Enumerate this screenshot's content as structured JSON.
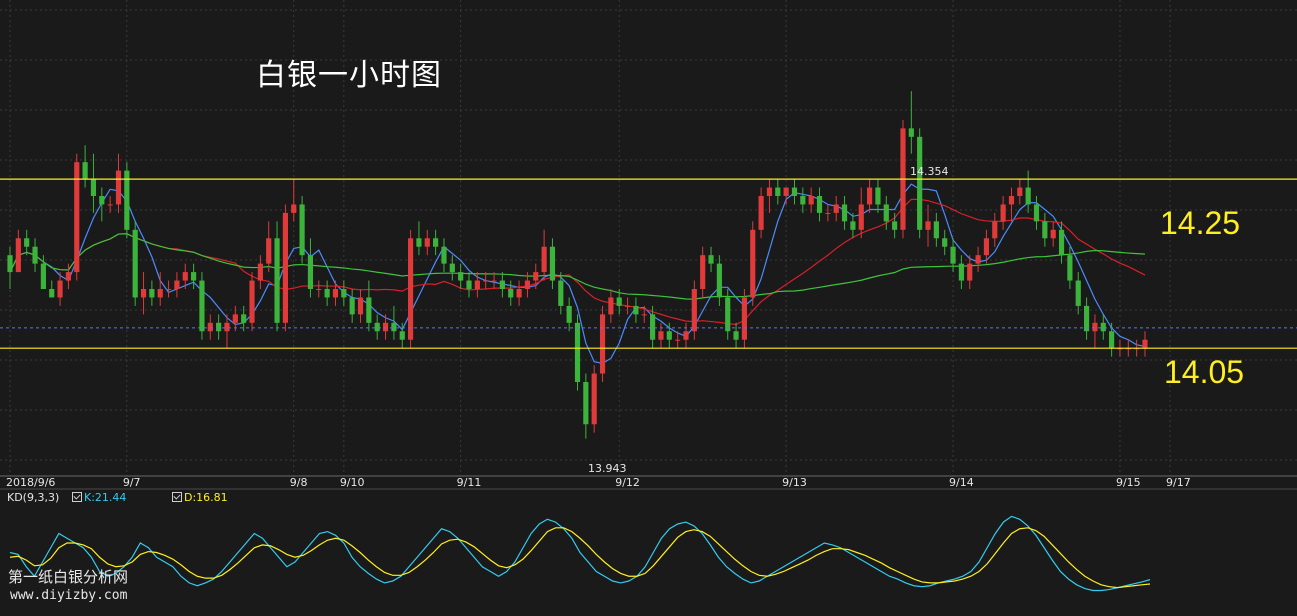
{
  "title": "白银一小时图",
  "chart_data": {
    "type": "candlestick",
    "y_range": [
      13.9,
      14.45
    ],
    "levels": [
      {
        "label": "14.25",
        "value": 14.25,
        "color": "#ffee22"
      },
      {
        "label": "14.05",
        "value": 14.05,
        "color": "#ffee22"
      }
    ],
    "dashed_level": {
      "value": 14.074,
      "color": "#5577ff"
    },
    "extremes": [
      {
        "label": "14.354",
        "value": 14.354
      },
      {
        "label": "13.943",
        "value": 13.943
      }
    ],
    "date_labels": [
      "2018/9/6",
      "9/7",
      "9/8",
      "9/10",
      "9/11",
      "9/12",
      "9/13",
      "9/14",
      "9/15",
      "9/17"
    ],
    "date_label_positions": [
      0,
      14,
      34,
      40,
      54,
      73,
      93,
      113,
      133,
      139
    ],
    "ohlc": [
      [
        14.16,
        14.17,
        14.12,
        14.14
      ],
      [
        14.14,
        14.19,
        14.14,
        14.18
      ],
      [
        14.18,
        14.19,
        14.16,
        14.17
      ],
      [
        14.17,
        14.18,
        14.14,
        14.15
      ],
      [
        14.15,
        14.16,
        14.12,
        14.12
      ],
      [
        14.12,
        14.13,
        14.11,
        14.11
      ],
      [
        14.11,
        14.14,
        14.1,
        14.13
      ],
      [
        14.13,
        14.15,
        14.12,
        14.14
      ],
      [
        14.14,
        14.28,
        14.13,
        14.27
      ],
      [
        14.27,
        14.29,
        14.24,
        14.25
      ],
      [
        14.25,
        14.28,
        14.21,
        14.23
      ],
      [
        14.23,
        14.24,
        14.2,
        14.22
      ],
      [
        14.22,
        14.23,
        14.21,
        14.22
      ],
      [
        14.22,
        14.28,
        14.21,
        14.26
      ],
      [
        14.26,
        14.27,
        14.18,
        14.19
      ],
      [
        14.19,
        14.2,
        14.1,
        14.11
      ],
      [
        14.11,
        14.14,
        14.09,
        14.12
      ],
      [
        14.12,
        14.13,
        14.1,
        14.11
      ],
      [
        14.11,
        14.14,
        14.1,
        14.12
      ],
      [
        14.12,
        14.13,
        14.11,
        14.12
      ],
      [
        14.12,
        14.14,
        14.11,
        14.13
      ],
      [
        14.13,
        14.15,
        14.12,
        14.14
      ],
      [
        14.14,
        14.15,
        14.12,
        14.13
      ],
      [
        14.13,
        14.14,
        14.06,
        14.07
      ],
      [
        14.07,
        14.09,
        14.06,
        14.08
      ],
      [
        14.08,
        14.09,
        14.06,
        14.07
      ],
      [
        14.07,
        14.09,
        14.05,
        14.08
      ],
      [
        14.08,
        14.1,
        14.07,
        14.09
      ],
      [
        14.09,
        14.1,
        14.07,
        14.08
      ],
      [
        14.08,
        14.14,
        14.07,
        14.13
      ],
      [
        14.13,
        14.16,
        14.12,
        14.15
      ],
      [
        14.15,
        14.2,
        14.14,
        14.18
      ],
      [
        14.18,
        14.2,
        14.07,
        14.08
      ],
      [
        14.08,
        14.22,
        14.07,
        14.21
      ],
      [
        14.21,
        14.25,
        14.2,
        14.22
      ],
      [
        14.22,
        14.23,
        14.15,
        14.16
      ],
      [
        14.16,
        14.18,
        14.11,
        14.12
      ],
      [
        14.12,
        14.13,
        14.11,
        14.12
      ],
      [
        14.12,
        14.13,
        14.1,
        14.11
      ],
      [
        14.11,
        14.13,
        14.1,
        14.12
      ],
      [
        14.12,
        14.13,
        14.1,
        14.11
      ],
      [
        14.11,
        14.12,
        14.08,
        14.09
      ],
      [
        14.09,
        14.12,
        14.08,
        14.11
      ],
      [
        14.11,
        14.13,
        14.07,
        14.08
      ],
      [
        14.08,
        14.09,
        14.06,
        14.07
      ],
      [
        14.07,
        14.09,
        14.06,
        14.08
      ],
      [
        14.08,
        14.1,
        14.06,
        14.07
      ],
      [
        14.07,
        14.08,
        14.05,
        14.06
      ],
      [
        14.06,
        14.19,
        14.05,
        14.18
      ],
      [
        14.18,
        14.2,
        14.16,
        14.17
      ],
      [
        14.17,
        14.19,
        14.16,
        14.18
      ],
      [
        14.18,
        14.19,
        14.16,
        14.17
      ],
      [
        14.17,
        14.18,
        14.14,
        14.15
      ],
      [
        14.15,
        14.16,
        14.13,
        14.14
      ],
      [
        14.14,
        14.15,
        14.12,
        14.13
      ],
      [
        14.13,
        14.14,
        14.11,
        14.12
      ],
      [
        14.12,
        14.14,
        14.11,
        14.13
      ],
      [
        14.13,
        14.14,
        14.12,
        14.13
      ],
      [
        14.13,
        14.14,
        14.12,
        14.13
      ],
      [
        14.13,
        14.14,
        14.11,
        14.12
      ],
      [
        14.12,
        14.13,
        14.1,
        14.11
      ],
      [
        14.11,
        14.13,
        14.1,
        14.12
      ],
      [
        14.12,
        14.14,
        14.11,
        14.13
      ],
      [
        14.13,
        14.15,
        14.12,
        14.14
      ],
      [
        14.14,
        14.19,
        14.13,
        14.17
      ],
      [
        14.17,
        14.18,
        14.12,
        14.13
      ],
      [
        14.13,
        14.14,
        14.09,
        14.1
      ],
      [
        14.1,
        14.11,
        14.07,
        14.08
      ],
      [
        14.08,
        14.09,
        14.0,
        14.01
      ],
      [
        14.01,
        14.02,
        13.943,
        13.96
      ],
      [
        13.96,
        14.03,
        13.95,
        14.02
      ],
      [
        14.02,
        14.1,
        14.01,
        14.09
      ],
      [
        14.09,
        14.12,
        14.08,
        14.11
      ],
      [
        14.11,
        14.12,
        14.09,
        14.1
      ],
      [
        14.1,
        14.11,
        14.09,
        14.1
      ],
      [
        14.1,
        14.11,
        14.08,
        14.09
      ],
      [
        14.09,
        14.1,
        14.08,
        14.09
      ],
      [
        14.09,
        14.1,
        14.05,
        14.06
      ],
      [
        14.06,
        14.08,
        14.05,
        14.07
      ],
      [
        14.07,
        14.08,
        14.05,
        14.06
      ],
      [
        14.06,
        14.07,
        14.05,
        14.06
      ],
      [
        14.06,
        14.08,
        14.05,
        14.07
      ],
      [
        14.07,
        14.13,
        14.06,
        14.12
      ],
      [
        14.12,
        14.17,
        14.11,
        14.16
      ],
      [
        14.16,
        14.17,
        14.14,
        14.15
      ],
      [
        14.15,
        14.16,
        14.1,
        14.11
      ],
      [
        14.11,
        14.12,
        14.06,
        14.07
      ],
      [
        14.07,
        14.08,
        14.05,
        14.06
      ],
      [
        14.06,
        14.12,
        14.05,
        14.11
      ],
      [
        14.11,
        14.2,
        14.1,
        14.19
      ],
      [
        14.19,
        14.24,
        14.18,
        14.23
      ],
      [
        14.23,
        14.25,
        14.21,
        14.24
      ],
      [
        14.24,
        14.25,
        14.22,
        14.23
      ],
      [
        14.23,
        14.24,
        14.22,
        14.24
      ],
      [
        14.24,
        14.25,
        14.22,
        14.23
      ],
      [
        14.23,
        14.24,
        14.21,
        14.22
      ],
      [
        14.22,
        14.24,
        14.21,
        14.23
      ],
      [
        14.23,
        14.24,
        14.2,
        14.21
      ],
      [
        14.21,
        14.22,
        14.2,
        14.21
      ],
      [
        14.21,
        14.23,
        14.2,
        14.22
      ],
      [
        14.22,
        14.23,
        14.19,
        14.2
      ],
      [
        14.2,
        14.21,
        14.18,
        14.19
      ],
      [
        14.19,
        14.24,
        14.18,
        14.22
      ],
      [
        14.22,
        14.25,
        14.21,
        14.24
      ],
      [
        14.24,
        14.25,
        14.21,
        14.22
      ],
      [
        14.22,
        14.23,
        14.19,
        14.2
      ],
      [
        14.2,
        14.21,
        14.18,
        14.19
      ],
      [
        14.19,
        14.32,
        14.18,
        14.31
      ],
      [
        14.31,
        14.354,
        14.28,
        14.3
      ],
      [
        14.3,
        14.31,
        14.18,
        14.19
      ],
      [
        14.19,
        14.22,
        14.17,
        14.2
      ],
      [
        14.2,
        14.21,
        14.17,
        14.18
      ],
      [
        14.18,
        14.19,
        14.16,
        14.17
      ],
      [
        14.17,
        14.18,
        14.14,
        14.15
      ],
      [
        14.15,
        14.16,
        14.12,
        14.13
      ],
      [
        14.13,
        14.16,
        14.12,
        14.15
      ],
      [
        14.15,
        14.17,
        14.14,
        14.16
      ],
      [
        14.16,
        14.19,
        14.15,
        14.18
      ],
      [
        14.18,
        14.21,
        14.17,
        14.2
      ],
      [
        14.2,
        14.23,
        14.19,
        14.22
      ],
      [
        14.22,
        14.24,
        14.2,
        14.23
      ],
      [
        14.23,
        14.25,
        14.22,
        14.24
      ],
      [
        14.24,
        14.26,
        14.21,
        14.22
      ],
      [
        14.22,
        14.23,
        14.19,
        14.2
      ],
      [
        14.2,
        14.21,
        14.17,
        14.18
      ],
      [
        14.18,
        14.2,
        14.17,
        14.19
      ],
      [
        14.19,
        14.2,
        14.15,
        14.16
      ],
      [
        14.16,
        14.17,
        14.12,
        14.13
      ],
      [
        14.13,
        14.14,
        14.09,
        14.1
      ],
      [
        14.1,
        14.11,
        14.06,
        14.07
      ],
      [
        14.07,
        14.09,
        14.05,
        14.08
      ],
      [
        14.08,
        14.09,
        14.06,
        14.07
      ],
      [
        14.07,
        14.08,
        14.04,
        14.05
      ],
      [
        14.05,
        14.06,
        14.04,
        14.05
      ],
      [
        14.05,
        14.06,
        14.04,
        14.05
      ],
      [
        14.05,
        14.06,
        14.04,
        14.05
      ],
      [
        14.05,
        14.07,
        14.04,
        14.06
      ]
    ],
    "series_colors": {
      "up": "#e03a3a",
      "down": "#3cb43c",
      "ma_short": "#4a8cff",
      "ma_mid": "#d8202a",
      "ma_long": "#3cc43c"
    },
    "kd": {
      "header": "KD(9,3,3)",
      "k_label": "K:21.44",
      "d_label": "D:16.81",
      "k_color": "#33ccee",
      "d_color": "#ffee22",
      "k_values": [
        50,
        48,
        35,
        25,
        40,
        55,
        70,
        65,
        60,
        55,
        45,
        30,
        25,
        28,
        35,
        45,
        60,
        55,
        45,
        40,
        35,
        25,
        18,
        15,
        18,
        22,
        30,
        40,
        50,
        60,
        70,
        65,
        55,
        45,
        35,
        40,
        50,
        60,
        70,
        72,
        68,
        60,
        45,
        35,
        28,
        22,
        18,
        20,
        25,
        35,
        45,
        55,
        65,
        75,
        72,
        65,
        55,
        45,
        35,
        30,
        25,
        30,
        40,
        55,
        70,
        80,
        85,
        82,
        75,
        65,
        50,
        40,
        30,
        25,
        20,
        18,
        20,
        25,
        35,
        50,
        65,
        75,
        80,
        82,
        78,
        70,
        58,
        45,
        35,
        28,
        22,
        18,
        20,
        25,
        30,
        35,
        40,
        45,
        50,
        55,
        60,
        58,
        55,
        50,
        45,
        40,
        35,
        30,
        25,
        22,
        18,
        15,
        14,
        15,
        18,
        20,
        22,
        25,
        30,
        40,
        55,
        70,
        82,
        88,
        85,
        78,
        68,
        55,
        42,
        30,
        22,
        16,
        12,
        10,
        10,
        11,
        13,
        15,
        17,
        19,
        21.44
      ],
      "d_values": [
        45,
        46,
        42,
        36,
        37,
        44,
        55,
        60,
        60,
        58,
        54,
        45,
        38,
        35,
        36,
        40,
        48,
        51,
        50,
        47,
        43,
        37,
        30,
        25,
        23,
        23,
        26,
        32,
        39,
        47,
        55,
        58,
        57,
        53,
        48,
        45,
        47,
        52,
        58,
        63,
        65,
        63,
        57,
        50,
        42,
        35,
        29,
        26,
        26,
        29,
        35,
        42,
        50,
        59,
        63,
        64,
        61,
        56,
        49,
        42,
        36,
        34,
        37,
        43,
        52,
        62,
        72,
        76,
        76,
        72,
        65,
        57,
        48,
        40,
        33,
        28,
        25,
        25,
        28,
        36,
        46,
        56,
        66,
        72,
        74,
        72,
        67,
        59,
        51,
        43,
        36,
        30,
        26,
        25,
        27,
        30,
        34,
        38,
        42,
        47,
        51,
        54,
        54,
        53,
        50,
        47,
        43,
        39,
        34,
        30,
        26,
        22,
        19,
        18,
        18,
        19,
        20,
        22,
        25,
        30,
        38,
        49,
        60,
        70,
        75,
        76,
        73,
        67,
        58,
        49,
        40,
        32,
        25,
        20,
        16,
        14,
        13,
        14,
        15,
        16,
        16.81
      ]
    }
  },
  "watermark": {
    "site_name": "第一纸白银分析网",
    "url": "www.diyizby.com"
  }
}
